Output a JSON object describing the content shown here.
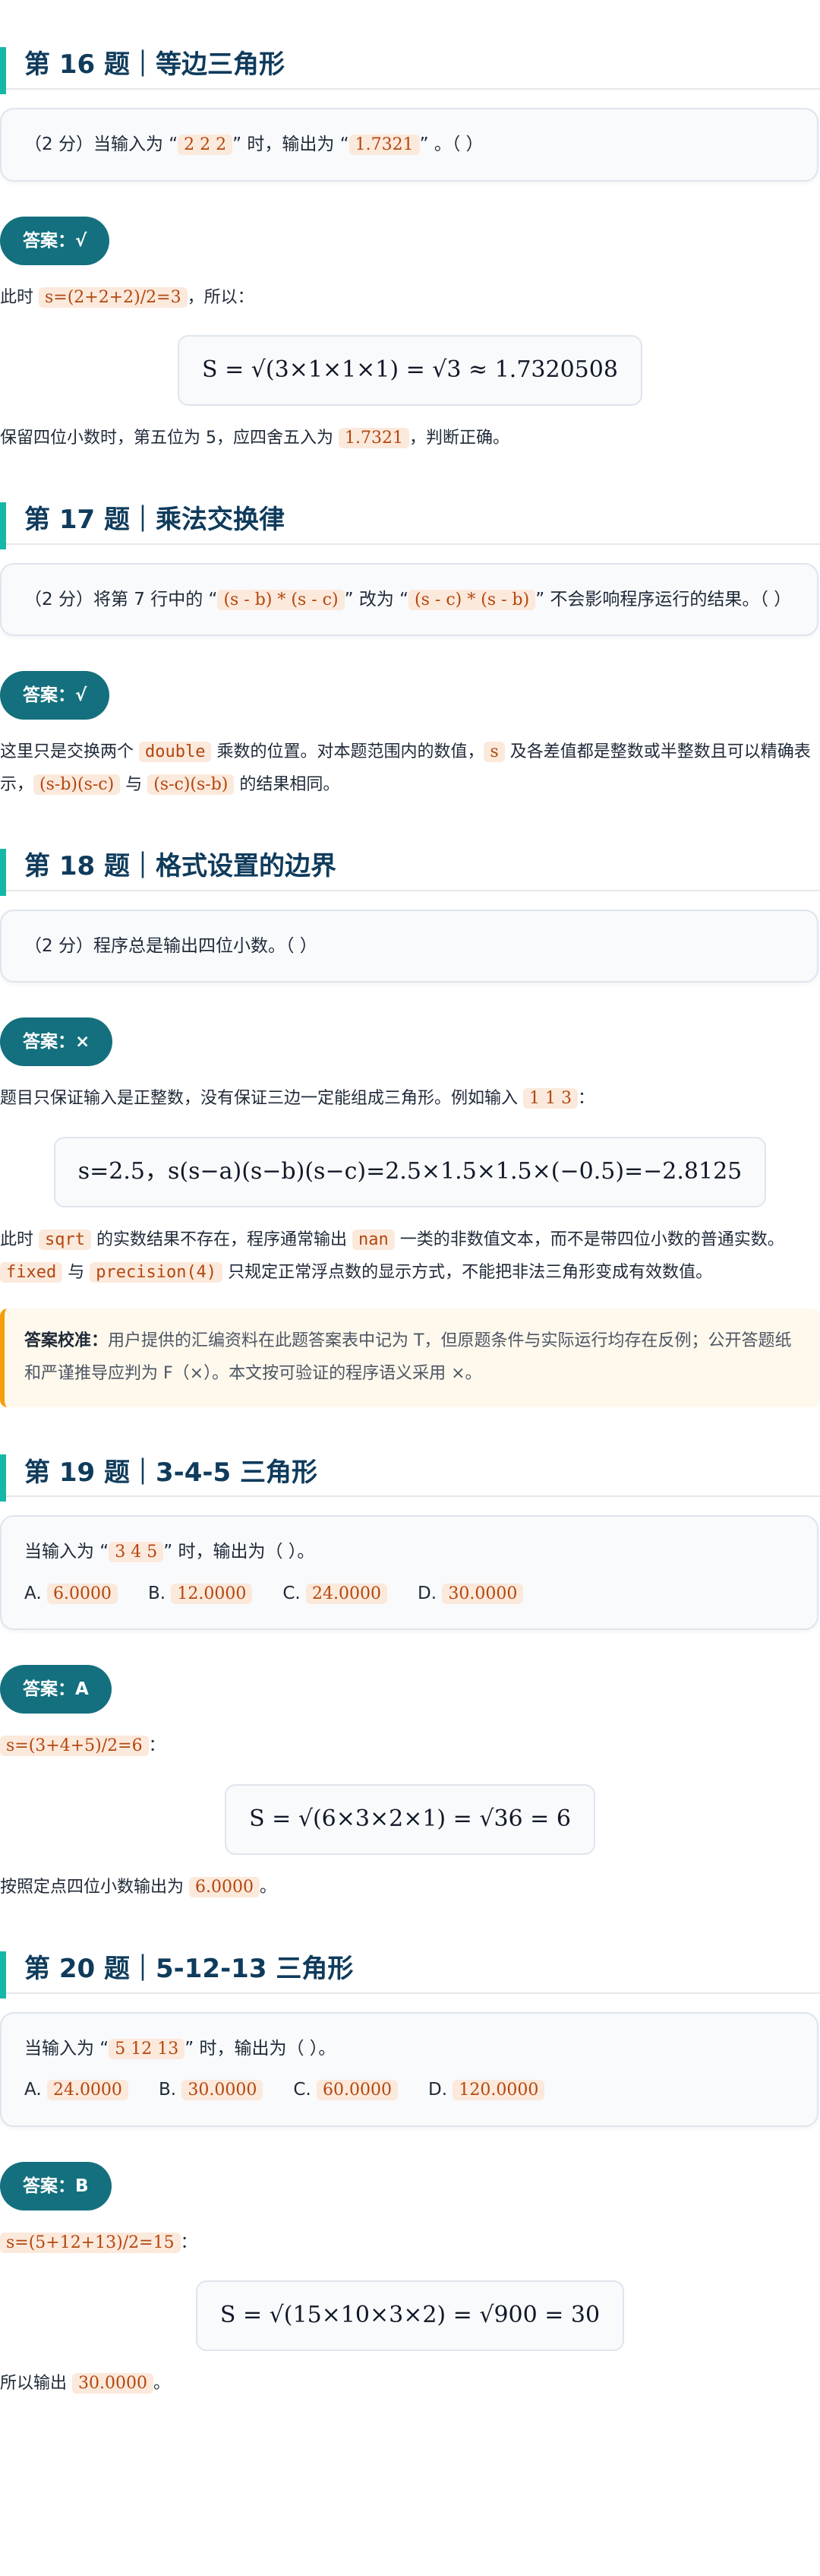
{
  "questions": [
    {
      "heading": "第 16 题｜等边三角形",
      "q": {
        "a": "（2 分）当输入为 “",
        "c1": "2 2 2",
        "b": "” 时，输出为 “",
        "c2": "1.7321",
        "d": "” 。（    ）"
      },
      "answer": "答案：√",
      "p1": {
        "a": "此时 ",
        "c1": "s=(2+2+2)/2=3",
        "b": "，所以："
      },
      "formula": "S = √(3×1×1×1) = √3 ≈ 1.7320508",
      "p2": {
        "a": "保留四位小数时，第五位为 5，应四舍五入为 ",
        "c1": "1.7321",
        "b": "，判断正确。"
      }
    },
    {
      "heading": "第 17 题｜乘法交换律",
      "q": {
        "a": "（2 分）将第 7 行中的 “",
        "c1": "(s - b) * (s - c)",
        "b": "” 改为 “",
        "c2": "(s - c) * (s - b)",
        "d": "” 不会影响程序运行的结果。（    ）"
      },
      "answer": "答案：√",
      "p1": {
        "a": "这里只是交换两个 ",
        "c1": "double",
        "b": " 乘数的位置。对本题范围内的数值，",
        "c2": "s",
        "c": " 及各差值都是整数或半整数且可以精确表示，",
        "c3": "(s-b)(s-c)",
        "d": " 与 ",
        "c4": "(s-c)(s-b)",
        "e": " 的结果相同。"
      }
    },
    {
      "heading": "第 18 题｜格式设置的边界",
      "q": {
        "a": "（2 分）程序总是输出四位小数。（    ）"
      },
      "answer": "答案：×",
      "p1": {
        "a": "题目只保证输入是正整数，没有保证三边一定能组成三角形。例如输入 ",
        "c1": "1 1 3",
        "b": "："
      },
      "formula": "s=2.5，s(s−a)(s−b)(s−c)=2.5×1.5×1.5×(−0.5)=−2.8125",
      "p2": {
        "a": "此时 ",
        "c1": "sqrt",
        "b": " 的实数结果不存在，程序通常输出 ",
        "c2": "nan",
        "c": " 一类的非数值文本，而不是带四位小数的普通实数。",
        "c3": "fixed",
        "d": " 与 ",
        "c4": "precision(4)",
        "e": " 只规定正常浮点数的显示方式，不能把非法三角形变成有效数值。"
      },
      "note": {
        "label": "答案校准：",
        "text": "用户提供的汇编资料在此题答案表中记为 T，但原题条件与实际运行均存在反例；公开答题纸和严谨推导应判为 F（×）。本文按可验证的程序语义采用 ×。"
      }
    },
    {
      "heading": "第 19 题｜3-4-5 三角形",
      "q": {
        "a": "当输入为 “",
        "c1": "3 4 5",
        "b": "” 时，输出为（    ）。"
      },
      "options": [
        {
          "label": "A.",
          "value": "6.0000"
        },
        {
          "label": "B.",
          "value": "12.0000"
        },
        {
          "label": "C.",
          "value": "24.0000"
        },
        {
          "label": "D.",
          "value": "30.0000"
        }
      ],
      "answer": "答案：A",
      "p1": {
        "c1": "s=(3+4+5)/2=6",
        "b": "："
      },
      "formula": "S = √(6×3×2×1) = √36 = 6",
      "p2": {
        "a": "按照定点四位小数输出为 ",
        "c1": "6.0000",
        "b": "。"
      }
    },
    {
      "heading": "第 20 题｜5-12-13 三角形",
      "q": {
        "a": "当输入为 “",
        "c1": "5 12 13",
        "b": "” 时，输出为（    ）。"
      },
      "options": [
        {
          "label": "A.",
          "value": "24.0000"
        },
        {
          "label": "B.",
          "value": "30.0000"
        },
        {
          "label": "C.",
          "value": "60.0000"
        },
        {
          "label": "D.",
          "value": "120.0000"
        }
      ],
      "answer": "答案：B",
      "p1": {
        "c1": "s=(5+12+13)/2=15",
        "b": "："
      },
      "formula": "S = √(15×10×3×2) = √900 = 30",
      "p2": {
        "a": "所以输出 ",
        "c1": "30.0000",
        "b": "。"
      }
    }
  ],
  "colors": {
    "accent": "#15b8a6",
    "heading": "#0f3b5c",
    "answer_pill": "#14707e",
    "code_bg": "#fbe9dc",
    "code_fg": "#b3470f",
    "note_border": "#f59e0b"
  }
}
